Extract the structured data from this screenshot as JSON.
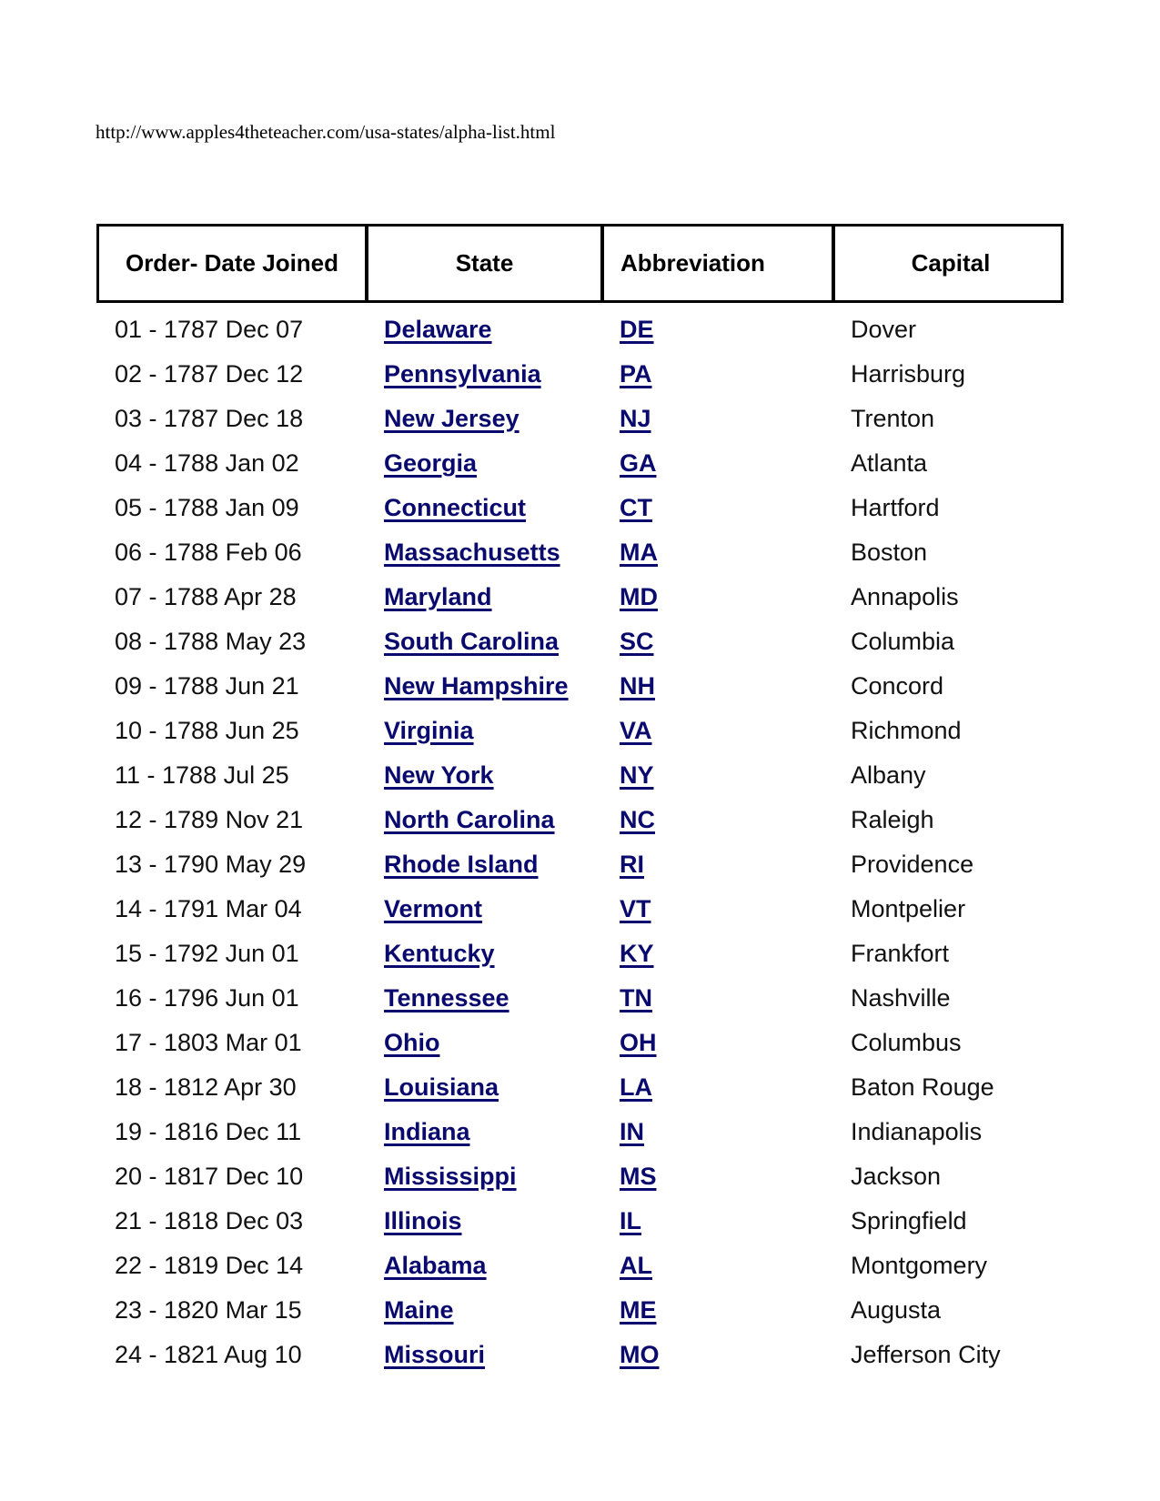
{
  "page": {
    "url_text": "http://www.apples4theteacher.com/usa-states/alpha-list.html"
  },
  "table": {
    "headers": {
      "order": "Order- Date Joined",
      "state": "State",
      "abbreviation": "Abbreviation",
      "capital": "Capital"
    },
    "rows": [
      {
        "order": "01 - 1787 Dec 07",
        "state": "Delaware",
        "abbr": "DE",
        "capital": "Dover"
      },
      {
        "order": "02 - 1787 Dec 12",
        "state": "Pennsylvania",
        "abbr": "PA",
        "capital": "Harrisburg"
      },
      {
        "order": "03 - 1787 Dec 18",
        "state": "New Jersey",
        "abbr": "NJ",
        "capital": "Trenton"
      },
      {
        "order": "04 - 1788 Jan 02",
        "state": "Georgia",
        "abbr": "GA",
        "capital": "Atlanta"
      },
      {
        "order": "05 - 1788 Jan 09",
        "state": "Connecticut",
        "abbr": "CT",
        "capital": "Hartford"
      },
      {
        "order": "06 - 1788 Feb 06",
        "state": "Massachusetts",
        "abbr": "MA",
        "capital": "Boston"
      },
      {
        "order": "07 - 1788 Apr 28",
        "state": "Maryland",
        "abbr": "MD",
        "capital": "Annapolis"
      },
      {
        "order": "08 - 1788 May 23",
        "state": "South Carolina",
        "abbr": "SC",
        "capital": "Columbia"
      },
      {
        "order": "09 - 1788 Jun 21",
        "state": "New Hampshire",
        "abbr": "NH",
        "capital": "Concord"
      },
      {
        "order": "10 - 1788 Jun 25",
        "state": "Virginia",
        "abbr": "VA",
        "capital": "Richmond"
      },
      {
        "order": "11 - 1788 Jul 25",
        "state": "New York",
        "abbr": "NY",
        "capital": "Albany"
      },
      {
        "order": "12 - 1789 Nov 21",
        "state": "North Carolina",
        "abbr": "NC",
        "capital": "Raleigh"
      },
      {
        "order": "13 - 1790 May 29",
        "state": "Rhode Island",
        "abbr": "RI",
        "capital": "Providence"
      },
      {
        "order": "14 - 1791 Mar 04",
        "state": "Vermont",
        "abbr": "VT",
        "capital": "Montpelier"
      },
      {
        "order": "15 - 1792 Jun 01",
        "state": "Kentucky",
        "abbr": "KY",
        "capital": "Frankfort"
      },
      {
        "order": "16 - 1796 Jun 01",
        "state": "Tennessee",
        "abbr": "TN",
        "capital": "Nashville"
      },
      {
        "order": "17 - 1803 Mar 01",
        "state": "Ohio",
        "abbr": "OH",
        "capital": "Columbus"
      },
      {
        "order": "18 - 1812 Apr 30",
        "state": "Louisiana",
        "abbr": "LA",
        "capital": "Baton Rouge"
      },
      {
        "order": "19 - 1816 Dec 11",
        "state": "Indiana",
        "abbr": "IN",
        "capital": "Indianapolis"
      },
      {
        "order": "20 - 1817 Dec 10",
        "state": "Mississippi",
        "abbr": "MS",
        "capital": "Jackson"
      },
      {
        "order": "21 - 1818 Dec 03",
        "state": "Illinois",
        "abbr": "IL",
        "capital": "Springfield"
      },
      {
        "order": "22 - 1819 Dec 14",
        "state": "Alabama",
        "abbr": "AL",
        "capital": "Montgomery"
      },
      {
        "order": "23 - 1820 Mar 15",
        "state": "Maine",
        "abbr": "ME",
        "capital": "Augusta"
      },
      {
        "order": "24 - 1821 Aug 10",
        "state": "Missouri",
        "abbr": "MO",
        "capital": "Jefferson City"
      }
    ]
  },
  "colors": {
    "link": "#0a0a6e",
    "text": "#111111",
    "border": "#000000"
  }
}
